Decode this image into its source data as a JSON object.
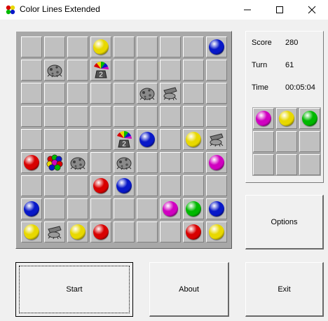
{
  "window": {
    "title": "Color Lines Extended"
  },
  "stats": {
    "score_label": "Score",
    "score_value": "280",
    "turn_label": "Turn",
    "turn_value": "61",
    "time_label": "Time",
    "time_value": "00:05:04"
  },
  "buttons": {
    "options": "Options",
    "start": "Start",
    "about": "About",
    "exit": "Exit"
  },
  "colors": {
    "yellow": "#e8d800",
    "blue": "#0818c8",
    "red": "#d80000",
    "magenta": "#d000c0",
    "green": "#00b800",
    "stone": "#8a8a8a"
  },
  "board": {
    "rows": 9,
    "cols": 9,
    "pieces": [
      {
        "r": 0,
        "c": 3,
        "t": "ball",
        "color": "yellow"
      },
      {
        "r": 0,
        "c": 8,
        "t": "ball",
        "color": "blue"
      },
      {
        "r": 1,
        "c": 1,
        "t": "rock-icon"
      },
      {
        "r": 1,
        "c": 3,
        "t": "rainbow-bomb-icon",
        "num": "2"
      },
      {
        "r": 2,
        "c": 5,
        "t": "rock-icon"
      },
      {
        "r": 2,
        "c": 6,
        "t": "cannon-icon"
      },
      {
        "r": 4,
        "c": 4,
        "t": "rainbow-bomb-icon",
        "num": "2"
      },
      {
        "r": 4,
        "c": 5,
        "t": "ball",
        "color": "blue"
      },
      {
        "r": 4,
        "c": 7,
        "t": "ball",
        "color": "yellow"
      },
      {
        "r": 4,
        "c": 8,
        "t": "cannon-icon"
      },
      {
        "r": 5,
        "c": 0,
        "t": "ball",
        "color": "red"
      },
      {
        "r": 5,
        "c": 1,
        "t": "multicolor-balls-icon"
      },
      {
        "r": 5,
        "c": 2,
        "t": "rock-icon"
      },
      {
        "r": 5,
        "c": 4,
        "t": "rock-icon"
      },
      {
        "r": 5,
        "c": 8,
        "t": "ball",
        "color": "magenta"
      },
      {
        "r": 6,
        "c": 3,
        "t": "ball",
        "color": "red"
      },
      {
        "r": 6,
        "c": 4,
        "t": "ball",
        "color": "blue"
      },
      {
        "r": 7,
        "c": 0,
        "t": "ball",
        "color": "blue"
      },
      {
        "r": 7,
        "c": 6,
        "t": "ball",
        "color": "magenta"
      },
      {
        "r": 7,
        "c": 7,
        "t": "ball",
        "color": "green"
      },
      {
        "r": 7,
        "c": 8,
        "t": "ball",
        "color": "blue"
      },
      {
        "r": 8,
        "c": 0,
        "t": "ball",
        "color": "yellow"
      },
      {
        "r": 8,
        "c": 1,
        "t": "cannon-icon"
      },
      {
        "r": 8,
        "c": 2,
        "t": "ball",
        "color": "yellow"
      },
      {
        "r": 8,
        "c": 3,
        "t": "ball",
        "color": "red"
      },
      {
        "r": 8,
        "c": 7,
        "t": "ball",
        "color": "red"
      },
      {
        "r": 8,
        "c": 8,
        "t": "ball",
        "color": "yellow"
      }
    ]
  },
  "next_preview": {
    "rows": 3,
    "cols": 3,
    "pieces": [
      {
        "r": 0,
        "c": 0,
        "color": "magenta"
      },
      {
        "r": 0,
        "c": 1,
        "color": "yellow"
      },
      {
        "r": 0,
        "c": 2,
        "color": "green"
      }
    ]
  }
}
